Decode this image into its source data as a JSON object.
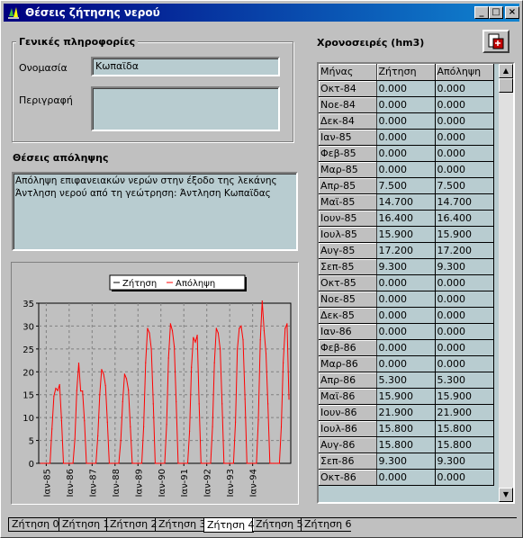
{
  "window": {
    "title": "Θέσεις ζήτησης νερού",
    "controls": [
      "_",
      "□",
      "×"
    ]
  },
  "general": {
    "title": "Γενικές πληροφορίες",
    "name_label": "Ονομασία",
    "name_value": "Κωπαϊδα",
    "description_label": "Περιγραφή",
    "description_value": ""
  },
  "abstraction": {
    "title": "Θέσεις απόληψης",
    "lines": [
      "Απόληψη επιφανειακών νερών στην έξοδο της λεκάνης",
      "Άντληση νερού από τη γεώτρηση: Άντληση Κωπαϊδας"
    ]
  },
  "timeseries": {
    "title": "Χρονοσειρές (hm3)",
    "columns": [
      "Μήνας",
      "Ζήτηση",
      "Απόληψη"
    ],
    "rows": [
      [
        "Οκτ-84",
        "0.000",
        "0.000"
      ],
      [
        "Νοε-84",
        "0.000",
        "0.000"
      ],
      [
        "Δεκ-84",
        "0.000",
        "0.000"
      ],
      [
        "Ιαν-85",
        "0.000",
        "0.000"
      ],
      [
        "Φεβ-85",
        "0.000",
        "0.000"
      ],
      [
        "Μαρ-85",
        "0.000",
        "0.000"
      ],
      [
        "Απρ-85",
        "7.500",
        "7.500"
      ],
      [
        "Μαϊ-85",
        "14.700",
        "14.700"
      ],
      [
        "Ιουν-85",
        "16.400",
        "16.400"
      ],
      [
        "Ιουλ-85",
        "15.900",
        "15.900"
      ],
      [
        "Αυγ-85",
        "17.200",
        "17.200"
      ],
      [
        "Σεπ-85",
        "9.300",
        "9.300"
      ],
      [
        "Οκτ-85",
        "0.000",
        "0.000"
      ],
      [
        "Νοε-85",
        "0.000",
        "0.000"
      ],
      [
        "Δεκ-85",
        "0.000",
        "0.000"
      ],
      [
        "Ιαν-86",
        "0.000",
        "0.000"
      ],
      [
        "Φεβ-86",
        "0.000",
        "0.000"
      ],
      [
        "Μαρ-86",
        "0.000",
        "0.000"
      ],
      [
        "Απρ-86",
        "5.300",
        "5.300"
      ],
      [
        "Μαϊ-86",
        "15.900",
        "15.900"
      ],
      [
        "Ιουν-86",
        "21.900",
        "21.900"
      ],
      [
        "Ιουλ-86",
        "15.800",
        "15.800"
      ],
      [
        "Αυγ-86",
        "15.800",
        "15.800"
      ],
      [
        "Σεπ-86",
        "9.300",
        "9.300"
      ],
      [
        "Οκτ-86",
        "0.000",
        "0.000"
      ]
    ]
  },
  "tabs": [
    "Ζήτηση 0",
    "Ζήτηση 1",
    "Ζήτηση 2",
    "Ζήτηση 3",
    "Ζήτηση 4",
    "Ζήτηση 5",
    "Ζήτηση 6"
  ],
  "active_tab": 4,
  "icons": {
    "app": "water-drops-icon",
    "tool": "export-icon"
  },
  "colors": {
    "title_start": "#000080",
    "title_end": "#1084d0",
    "series": "#ff0000",
    "field_bg": "#b8ccd0"
  },
  "chart_data": {
    "type": "line",
    "title": "",
    "legend": [
      "Ζήτηση",
      "Απόληψη"
    ],
    "legend_placement": "top-center",
    "grid": true,
    "ylim": [
      0,
      35
    ],
    "yticks": [
      0,
      5,
      10,
      15,
      20,
      25,
      30,
      35
    ],
    "xticks": [
      "Ιαν-85",
      "Ιαν-86",
      "Ιαν-87",
      "Ιαν-88",
      "Ιαν-89",
      "Ιαν-90",
      "Ιαν-91",
      "Ιαν-92",
      "Ιαν-93",
      "Ιαν-94"
    ],
    "x_start": "Οκτ-84",
    "series": [
      {
        "name": "Ζήτηση",
        "color": "#000000"
      },
      {
        "name": "Απόληψη",
        "color": "#ff0000",
        "values": [
          0,
          0,
          0,
          0,
          0,
          0,
          7.5,
          14.7,
          16.4,
          15.9,
          17.2,
          9.3,
          0,
          0,
          0,
          0,
          0,
          0,
          5.3,
          15.9,
          21.9,
          15.8,
          15.8,
          9.3,
          0,
          0,
          0,
          0,
          0,
          0,
          6,
          15,
          20.5,
          19.5,
          17,
          9,
          0,
          0,
          0,
          0,
          0,
          0,
          5,
          13.5,
          19.5,
          18.5,
          16,
          8,
          0,
          0,
          0,
          0,
          0,
          0,
          8,
          22,
          29.5,
          28.5,
          25,
          13,
          0,
          0,
          0,
          0,
          0,
          0,
          8.5,
          23,
          30.5,
          29,
          25.5,
          13.5,
          0,
          0,
          0,
          0,
          0,
          0,
          7,
          21,
          27.5,
          26.5,
          28,
          13,
          0,
          0,
          0,
          0,
          0,
          0,
          8,
          22,
          29.5,
          28.5,
          25,
          13,
          0,
          0,
          0,
          0,
          0,
          0,
          9,
          25,
          29.5,
          30,
          27,
          14,
          0,
          0,
          0,
          0,
          0,
          0,
          9.5,
          27,
          35.5,
          29,
          24,
          13,
          0,
          0,
          0,
          0,
          0,
          0,
          8,
          22,
          29.5,
          30.5,
          14
        ]
      }
    ]
  }
}
